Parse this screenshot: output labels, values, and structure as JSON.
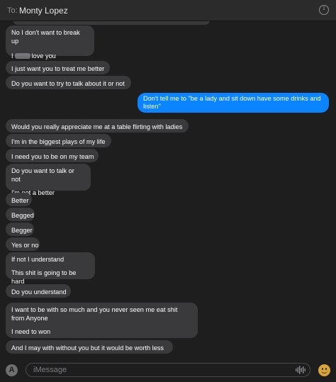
{
  "header": {
    "to_label": "To:",
    "recipient": "Monty Lopez",
    "info_icon": "info-circle-icon"
  },
  "messages": [
    {
      "side": "received",
      "lines": [
        "No I don't want to break up",
        "I love you"
      ],
      "redacted": true
    },
    {
      "side": "received",
      "text": "I just want you to treat me better"
    },
    {
      "side": "received",
      "text": "Do you want to try to talk about it or not"
    },
    {
      "side": "sent",
      "text": "Don't tell me to \"be a lady and sit down have some drinks and listen\""
    },
    {
      "side": "received",
      "text": "Would you really appreciate me at a table flirting with ladies"
    },
    {
      "side": "received",
      "text": "I'm in the biggest plays of my life"
    },
    {
      "side": "received",
      "text": "I need you to be on my team"
    },
    {
      "side": "received",
      "lines": [
        "Do you want to talk or not",
        "I'm not a better"
      ]
    },
    {
      "side": "received",
      "text": "Better"
    },
    {
      "side": "received",
      "text": "Begged"
    },
    {
      "side": "received",
      "text": "Begger"
    },
    {
      "side": "received",
      "text": "Yes or no"
    },
    {
      "side": "received",
      "lines": [
        "If not I understand",
        "This shit is going to be hard"
      ]
    },
    {
      "side": "received",
      "text": "Do you understand"
    },
    {
      "side": "received",
      "lines": [
        "I want to be with so much and you never seen me eat shit from Anyone",
        "I need to won"
      ]
    },
    {
      "side": "received",
      "text": "And  I may with without you but it would be worth less"
    }
  ],
  "composer": {
    "placeholder": "iMessage",
    "apps_icon": "app-store-icon",
    "audio_icon": "audio-waveform-icon",
    "emoji_icon": "emoji-icon"
  },
  "colors": {
    "background": "#1e1e1e",
    "received_bubble": "#3a3a3c",
    "sent_bubble": "#0a84ff"
  }
}
